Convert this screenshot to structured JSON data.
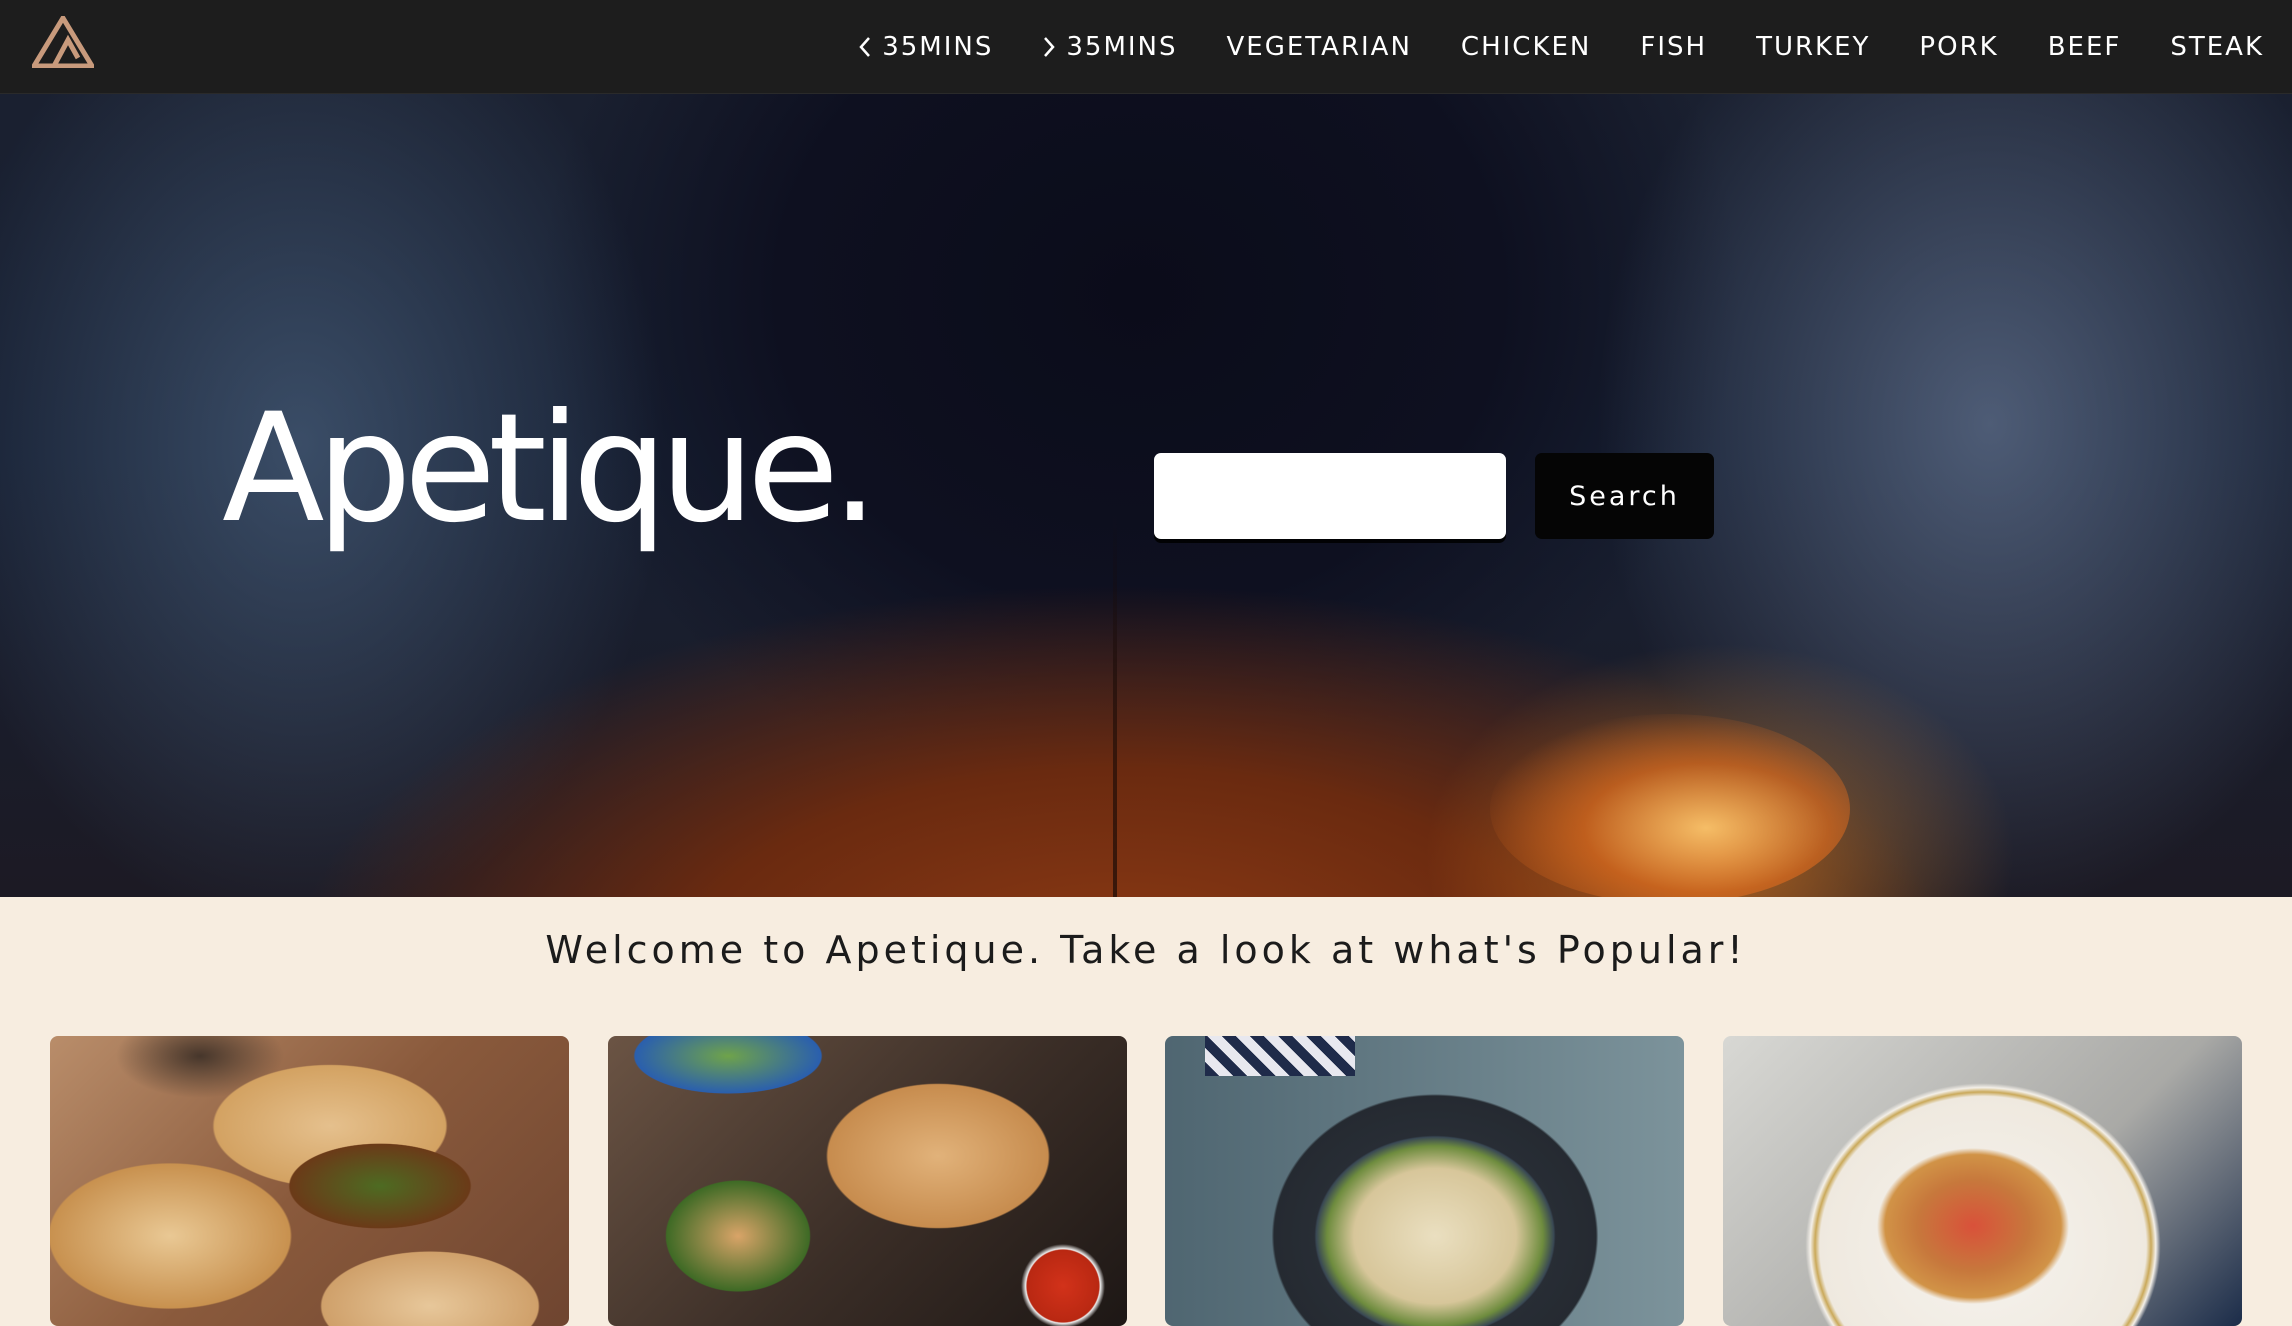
{
  "app": {
    "brand": "Apetique."
  },
  "nav": {
    "items": [
      {
        "label": "35MINS",
        "icon": "chevron-left-icon"
      },
      {
        "label": "35MINS",
        "icon": "chevron-right-icon"
      },
      {
        "label": "VEGETARIAN"
      },
      {
        "label": "CHICKEN"
      },
      {
        "label": "FISH"
      },
      {
        "label": "TURKEY"
      },
      {
        "label": "PORK"
      },
      {
        "label": "BEEF"
      },
      {
        "label": "STEAK"
      }
    ]
  },
  "hero": {
    "title": "Apetique.",
    "search": {
      "value": "",
      "placeholder": ""
    },
    "search_button": "Search"
  },
  "popular": {
    "heading": "Welcome to Apetique. Take a look at what's Popular!",
    "cards": [
      {
        "image": "focaccia-sandwich"
      },
      {
        "image": "broccoli-calzone"
      },
      {
        "image": "broccoli-pasta"
      },
      {
        "image": "tomato-spaghetti"
      }
    ]
  },
  "colors": {
    "navbar": "#1d1d1d",
    "logo": "#c89a7c",
    "page_bg": "#f7ede0",
    "search_button": "#050505"
  }
}
